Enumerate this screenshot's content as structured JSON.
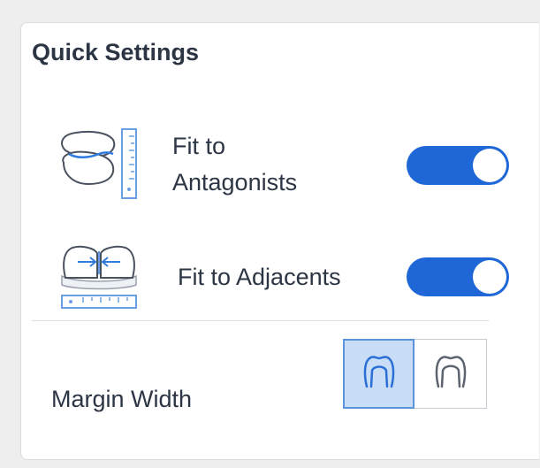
{
  "quick_settings": {
    "title": "Quick Settings",
    "fit_antagonists": {
      "label_line1": "Fit to",
      "label_line2": "Antagonists",
      "enabled": true,
      "icon": "antagonist-fit-icon"
    },
    "fit_adjacents": {
      "label": "Fit to Adjacents",
      "enabled": true,
      "icon": "adjacent-fit-icon"
    },
    "margin_width": {
      "label": "Margin Width",
      "options": [
        {
          "icon": "tooth-wide-margin-icon",
          "selected": true
        },
        {
          "icon": "tooth-narrow-margin-icon",
          "selected": false
        }
      ]
    }
  },
  "colors": {
    "accent": "#1f67d6",
    "selected_bg": "#c9ddf6",
    "text": "#2c3544"
  }
}
